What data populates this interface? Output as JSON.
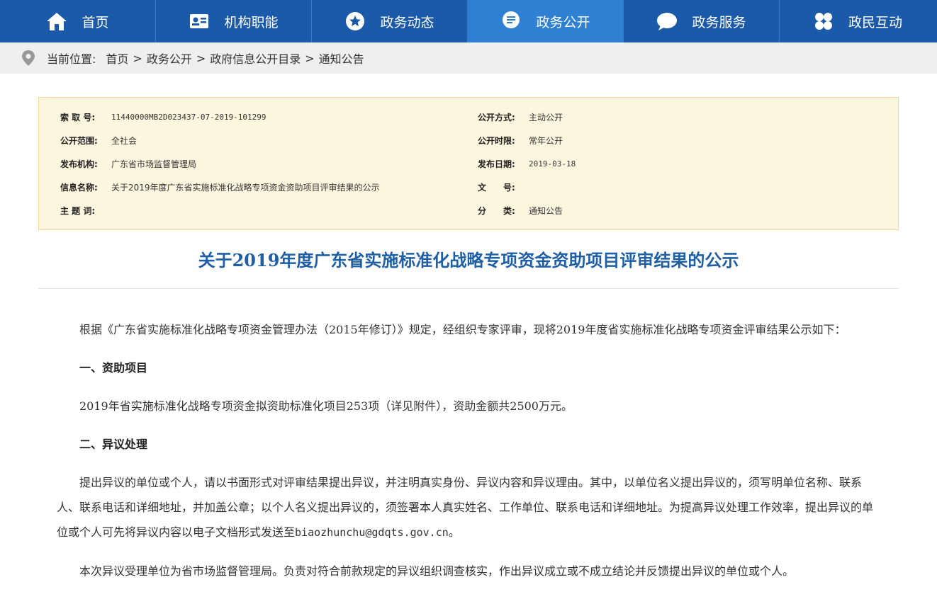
{
  "nav": {
    "items": [
      {
        "label": "首页",
        "icon": "home-icon",
        "active": false
      },
      {
        "label": "机构职能",
        "icon": "id-card-icon",
        "active": false
      },
      {
        "label": "政务动态",
        "icon": "star-icon",
        "active": false
      },
      {
        "label": "政务公开",
        "icon": "document-icon",
        "active": true
      },
      {
        "label": "政务服务",
        "icon": "chat-icon",
        "active": false
      },
      {
        "label": "政民互动",
        "icon": "grid-icon",
        "active": false
      }
    ]
  },
  "breadcrumb": {
    "prefix": "当前位置:",
    "items": [
      "首页",
      "政务公开",
      "政府信息公开目录",
      "通知公告"
    ],
    "separator": ">"
  },
  "meta": {
    "index_no_label": "索 取 号:",
    "index_no_value": "11440000MB2D023437-07-2019-101299",
    "scope_label": "公开范围:",
    "scope_value": "全社会",
    "publisher_label": "发布机构:",
    "publisher_value": "广东省市场监督管理局",
    "info_name_label": "信息名称:",
    "info_name_value": "关于2019年度广东省实施标准化战略专项资金资助项目评审结果的公示",
    "subject_label": "主 题 词:",
    "subject_value": "",
    "method_label": "公开方式:",
    "method_value": "主动公开",
    "period_label": "公开时限:",
    "period_value": "常年公开",
    "date_label": "发布日期:",
    "date_value": "2019-03-18",
    "doc_no_label": "文　　号:",
    "doc_no_value": "",
    "category_label": "分　　类:",
    "category_value": "通知公告"
  },
  "article": {
    "title": "关于2019年度广东省实施标准化战略专项资金资助项目评审结果的公示",
    "intro": "根据《广东省实施标准化战略专项资金管理办法（2015年修订）》规定，经组织专家评审，现将2019年度省实施标准化战略专项资金评审结果公示如下：",
    "section1_title": "一、资助项目",
    "section1_text": "2019年省实施标准化战略专项资金拟资助标准化项目253项（详见附件），资助金额共2500万元。",
    "section2_title": "二、异议处理",
    "section2_text_a": "提出异议的单位或个人，请以书面形式对评审结果提出异议，并注明真实身份、异议内容和异议理由。其中，以单位名义提出异议的，须写明单位名称、联系人、联系电话和详细地址，并加盖公章；以个人名义提出异议的，须签署本人真实姓名、工作单位、联系电话和详细地址。为提高异议处理工作效率，提出异议的单位或个人可先将异议内容以电子文档形式发送至",
    "email": "biaozhunchu@gdqts.gov.cn",
    "section2_text_b": "。",
    "section2_text2": "本次异议受理单位为省市场监督管理局。负责对符合前款规定的异议组织调查核实，作出异议成立或不成立结论并反馈提出异议的单位或个人。"
  },
  "colors": {
    "nav_bg": "#1a5aa8",
    "nav_active": "#2f7fd3",
    "title": "#1f5fa6",
    "meta_bg": "#fdf6df",
    "meta_border": "#f2d79e"
  }
}
